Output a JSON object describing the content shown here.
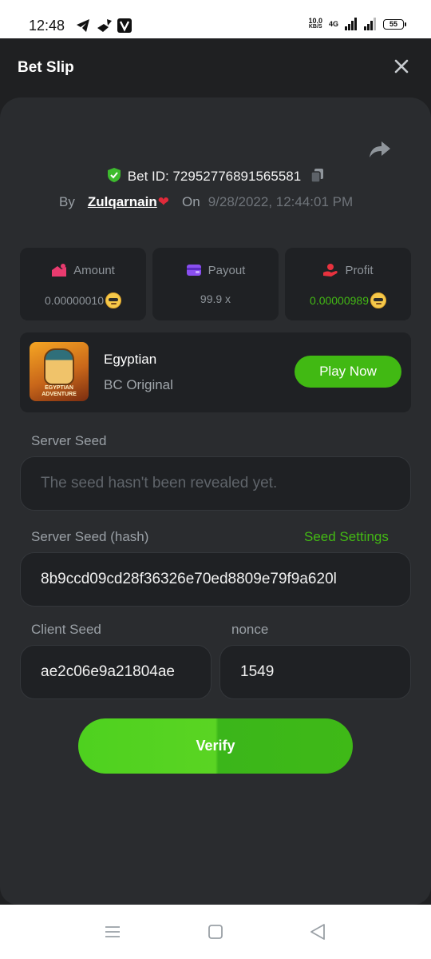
{
  "status_bar": {
    "time": "12:48",
    "net_speed_value": "10.0",
    "net_speed_unit": "KB/S",
    "network": "4G",
    "battery": "55"
  },
  "header": {
    "title": "Bet Slip"
  },
  "bet": {
    "id_label": "Bet ID: 72952776891565581",
    "by_label": "By",
    "username": "Zulqarnain",
    "on_label": "On",
    "datetime": "9/28/2022, 12:44:01 PM"
  },
  "stats": {
    "amount": {
      "label": "Amount",
      "value": "0.00000010"
    },
    "payout": {
      "label": "Payout",
      "value": "99.9 x"
    },
    "profit": {
      "label": "Profit",
      "value": "0.00000989"
    }
  },
  "game": {
    "name": "Egyptian",
    "provider": "BC Original",
    "thumb_text_1": "EGYPTIAN",
    "thumb_text_2": "ADVENTURE",
    "play_label": "Play Now"
  },
  "seeds": {
    "server_seed_label": "Server Seed",
    "server_seed_placeholder": "The seed hasn't been revealed yet.",
    "server_hash_label": "Server Seed (hash)",
    "seed_settings_label": "Seed Settings",
    "server_hash_value": "8b9ccd09cd28f36326e70ed8809e79f9a620l",
    "client_seed_label": "Client Seed",
    "client_seed_value": "ae2c06e9a21804ae",
    "nonce_label": "nonce",
    "nonce_value": "1549"
  },
  "verify_label": "Verify",
  "colors": {
    "accent_green": "#41b913",
    "profit_green": "#43b914",
    "background": "#1f2022",
    "card": "#2a2c2f"
  }
}
